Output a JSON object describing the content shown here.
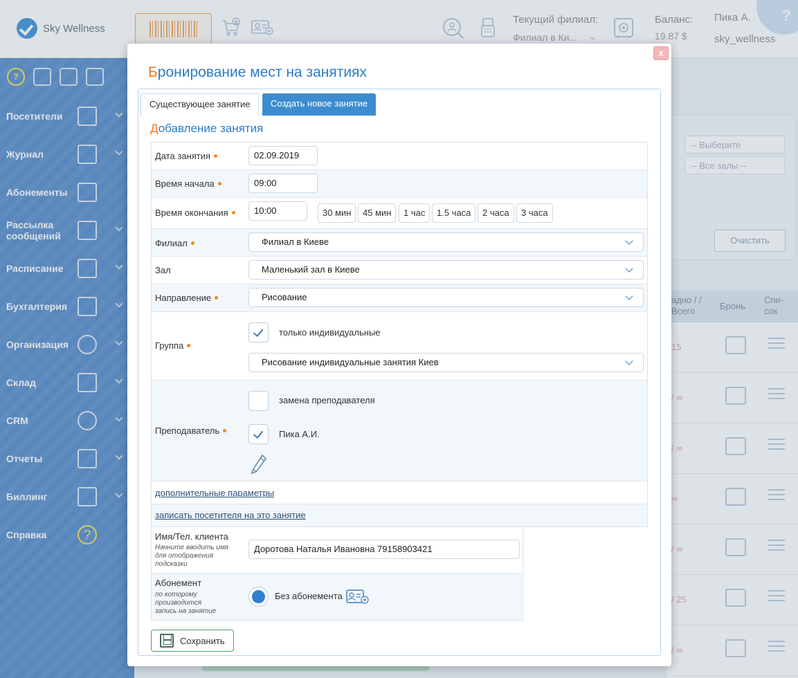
{
  "header": {
    "logo_text": "Sky Wellness",
    "branch_label": "Текущий филиал:",
    "branch_value": "Филиал в Ки...",
    "balance_label": "Баланс:",
    "balance_value": "19.87 $",
    "user_name": "Пика А.",
    "user_login": "sky_wellness",
    "help_symbol": "?"
  },
  "sidebar": {
    "help_symbol": "?",
    "items": [
      {
        "label": "Посетители",
        "icon": "visitor-icon"
      },
      {
        "label": "Журнал",
        "icon": "book-icon"
      },
      {
        "label": "Абонементы",
        "icon": "card-icon"
      },
      {
        "label": "Рассылка сообщений",
        "icon": "phone-message-icon"
      },
      {
        "label": "Расписание",
        "icon": "schedule-icon"
      },
      {
        "label": "Бухгалтерия",
        "icon": "calculator-icon"
      },
      {
        "label": "Организация",
        "icon": "gear-icon"
      },
      {
        "label": "Склад",
        "icon": "warehouse-icon"
      },
      {
        "label": "CRM",
        "icon": "crm-icon"
      },
      {
        "label": "Отчеты",
        "icon": "chart-icon"
      },
      {
        "label": "Биллинг",
        "icon": "invoice-icon"
      },
      {
        "label": "Справка",
        "icon": "help-icon"
      }
    ]
  },
  "background": {
    "select1": "-- Выберите",
    "select2": "-- Все залы --",
    "clear_label": "Очистить",
    "col_free": "адно / / Всего",
    "col_booking": "Бронь",
    "col_list": "Спи- сок",
    "rows": [
      "15",
      "/ ∞",
      "/ ∞",
      "∞",
      "/ ∞",
      "/ 25",
      "/ ∞"
    ]
  },
  "modal": {
    "close_label": "x",
    "title_first": "Б",
    "title_rest": "ронирование мест на занятиях",
    "tab_existing": "Существующее занятие",
    "tab_new": "Создать новое занятие",
    "section_first": "Д",
    "section_rest": "обавление занятия",
    "fields": {
      "date_label": "Дата занятия",
      "date_value": "02.09.2019",
      "start_label": "Время начала",
      "start_value": "09:00",
      "end_label": "Время окончания",
      "end_value": "10:00",
      "duration_buttons": [
        "30 мин",
        "45 мин",
        "1 час",
        "1.5 часа",
        "2 часа",
        "3 часа"
      ],
      "branch_label": "Филиал",
      "branch_value": "Филиал в Киеве",
      "hall_label": "Зал",
      "hall_value": "Маленький зал в Киеве",
      "direction_label": "Направление",
      "direction_value": "Рисование",
      "group_label": "Группа",
      "only_individual_label": "только индивидуальные",
      "group_value": "Рисование индивидуальные занятия Киев",
      "teacher_label": "Преподаватель",
      "replace_teacher_label": "замена преподавателя",
      "teacher_name": "Пика А.И.",
      "extra_params_link": "дополнительные параметры",
      "enroll_link": "записать посетителя на это занятие"
    },
    "client": {
      "label": "Имя/Тел. клиента",
      "hint": "Начните вводить имя для отображения подсказки",
      "value": "Доротова Наталья Ивановна 79158903421"
    },
    "subscription": {
      "label": "Абонемент",
      "hint": "по которому производится запись на занятие",
      "value": "Без абонемента"
    },
    "save_label": "Сохранить"
  }
}
